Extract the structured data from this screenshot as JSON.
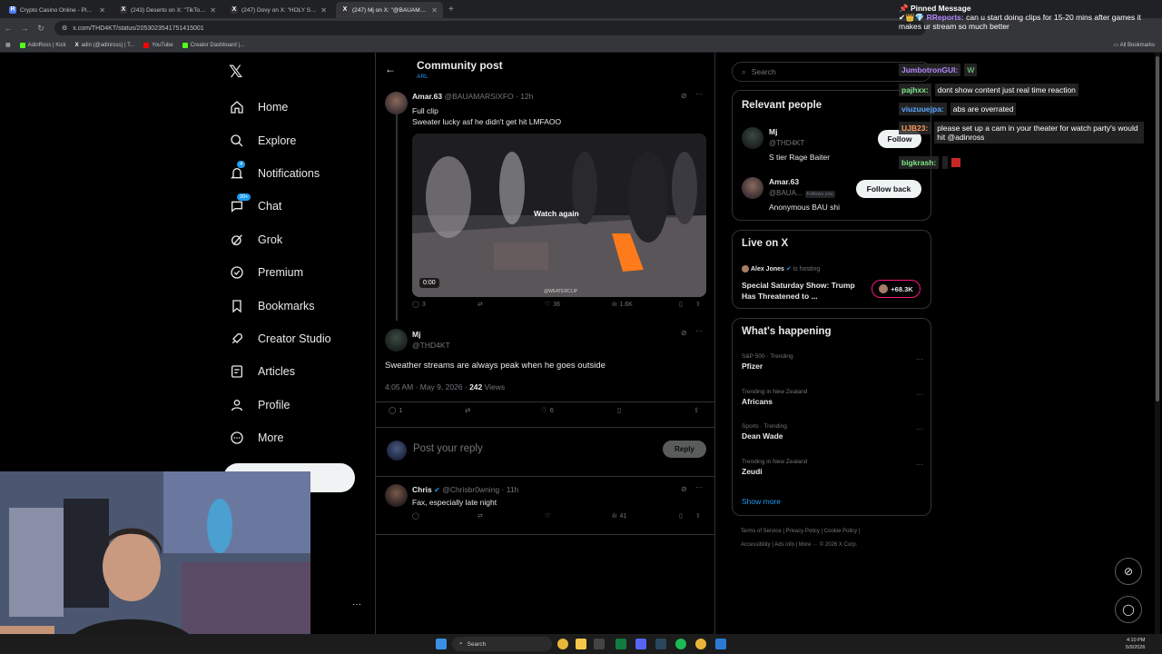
{
  "browser": {
    "tabs": [
      {
        "title": "Crypto Casino Online - Play with",
        "fav_color": "#4d7cfe",
        "fav": "R",
        "active": false
      },
      {
        "title": "(243) Deserto on X: \"TikTok pra",
        "fav_color": "#000000",
        "fav": "X",
        "active": false
      },
      {
        "title": "(247) Dovy on X: \"HOLY SMOKE",
        "fav_color": "#000000",
        "fav": "X",
        "active": false
      },
      {
        "title": "(247) Mj on X: \"@BAUAMARSIXFO",
        "fav_color": "#000000",
        "fav": "X",
        "active": true
      }
    ],
    "url": "x.com/THD4KT/status/2053023541751415001",
    "bookmarks": [
      {
        "label": "AdinRoss | Kick",
        "color": "#53fc18"
      },
      {
        "label": "adin (@adinross) | T...",
        "color": "#ffffff"
      },
      {
        "label": "YouTube",
        "color": "#ff0000"
      },
      {
        "label": "Creator Dashboard |...",
        "color": "#53fc18"
      }
    ],
    "all_bookmarks": "All Bookmarks"
  },
  "nav": {
    "items": [
      {
        "label": "Home",
        "icon": "home-icon"
      },
      {
        "label": "Explore",
        "icon": "search-icon"
      },
      {
        "label": "Notifications",
        "icon": "bell-icon",
        "badge": "4"
      },
      {
        "label": "Chat",
        "icon": "chat-icon",
        "badge": "20+"
      },
      {
        "label": "Grok",
        "icon": "grok-icon"
      },
      {
        "label": "Premium",
        "icon": "premium-icon"
      },
      {
        "label": "Bookmarks",
        "icon": "bookmark-icon"
      },
      {
        "label": "Creator Studio",
        "icon": "rocket-icon"
      },
      {
        "label": "Articles",
        "icon": "article-icon"
      },
      {
        "label": "Profile",
        "icon": "profile-icon"
      },
      {
        "label": "More",
        "icon": "more-icon"
      }
    ]
  },
  "main": {
    "header_title": "Community post",
    "header_sub": "ARL",
    "post1": {
      "name": "Amar.63",
      "handle": "@BAUAMARSIXFO",
      "time": "· 12h",
      "text1": "Full clip",
      "text2": "Sweater lucky asf he didn't get hit LMFAOO",
      "watch_again": "Watch again",
      "duration": "0:00",
      "watermark": "@WEATERCLIP",
      "replies": "3",
      "likes": "36",
      "views": "1.6K"
    },
    "post2": {
      "name": "Mj",
      "handle": "@THD4KT",
      "text": "Sweather streams are always peak when he goes outside",
      "timestamp": "4:05 AM · May 9, 2026 · ",
      "views_count": "242",
      "views_label": " Views",
      "replies": "1",
      "likes": "6"
    },
    "reply_placeholder": "Post your reply",
    "reply_button": "Reply",
    "post3": {
      "name": "Chris",
      "handle": "@Chrisbr0wning",
      "time": "· 11h",
      "text": "Fax, especially late night",
      "views": "41"
    }
  },
  "sidebar": {
    "search_placeholder": "Search",
    "relevant_title": "Relevant people",
    "people": [
      {
        "name": "Mj",
        "handle": "@THD4KT",
        "bio": "S tier Rage Baiter",
        "button": "Follow"
      },
      {
        "name": "Amar.63",
        "handle": "@BAUA...",
        "follows_you": "Follows you",
        "bio": "Anonymous BAU shi",
        "button": "Follow back"
      }
    ],
    "live_title": "Live on X",
    "live": {
      "host": "Alex Jones",
      "hosting": "is hosting",
      "title": "Special Saturday Show: Trump Has Threatened to ...",
      "count": "+68.3K"
    },
    "happening_title": "What's happening",
    "trends": [
      {
        "category": "S&P 500 · Trending",
        "name": "Pfizer"
      },
      {
        "category": "Trending in New Zealand",
        "name": "Africans"
      },
      {
        "category": "Sports · Trending",
        "name": "Dean Wade"
      },
      {
        "category": "Trending in New Zealand",
        "name": "Zeudi"
      }
    ],
    "show_more": "Show more",
    "footer1": "Terms of Service  |  Privacy Policy  |  Cookie Policy  |",
    "footer2": "Accessibility  |  Ads info  |  More ···  © 2026 X Corp."
  },
  "chat": {
    "pinned_title": "Pinned Message",
    "pinned_user": "RReports:",
    "pinned_text": "can u start doing clips for 15-20 mins after games it makes ur stream so much better",
    "lines": [
      {
        "user": "JumbotronGUI:",
        "msg": "W",
        "color": "#b388ff"
      },
      {
        "user": "pajhxx:",
        "msg": "dont show content just real time reaction",
        "color": "#7ee787"
      },
      {
        "user": "viuzuuejpa:",
        "msg": "abs are overrated",
        "color": "#58a6ff"
      },
      {
        "user": "UJB23:",
        "msg": "please set up a cam in your theater for watch party's would hit @adinross",
        "color": "#ff9d5c"
      },
      {
        "user": "bigkrash:",
        "msg": "",
        "color": "#7ee787"
      }
    ]
  },
  "taskbar": {
    "search": "Search",
    "time": "4:10 PM",
    "date": "5/9/2026"
  },
  "colors": {
    "accent": "#1d9bf0",
    "bg": "#000000",
    "border": "#2f3336"
  }
}
